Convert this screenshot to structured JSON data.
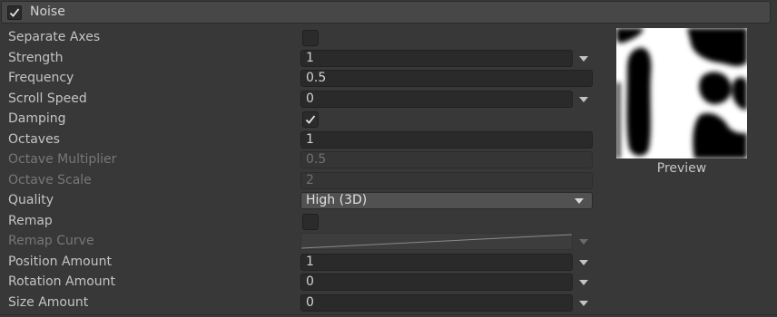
{
  "header": {
    "title": "Noise",
    "enabled": true
  },
  "rows": {
    "separate_axes": {
      "label": "Separate Axes",
      "checked": false
    },
    "strength": {
      "label": "Strength",
      "value": "1"
    },
    "frequency": {
      "label": "Frequency",
      "value": "0.5"
    },
    "scroll_speed": {
      "label": "Scroll Speed",
      "value": "0"
    },
    "damping": {
      "label": "Damping",
      "checked": true
    },
    "octaves": {
      "label": "Octaves",
      "value": "1"
    },
    "octave_multiplier": {
      "label": "Octave Multiplier",
      "value": "0.5",
      "disabled": true
    },
    "octave_scale": {
      "label": "Octave Scale",
      "value": "2",
      "disabled": true
    },
    "quality": {
      "label": "Quality",
      "value": "High (3D)"
    },
    "remap": {
      "label": "Remap",
      "checked": false
    },
    "remap_curve": {
      "label": "Remap Curve",
      "disabled": true
    },
    "position_amount": {
      "label": "Position Amount",
      "value": "1"
    },
    "rotation_amount": {
      "label": "Rotation Amount",
      "value": "0"
    },
    "size_amount": {
      "label": "Size Amount",
      "value": "0"
    }
  },
  "preview": {
    "label": "Preview"
  },
  "colors": {
    "background": "#383838",
    "field": "#2a2a2a",
    "text": "#c4c4c4",
    "disabled_text": "#777777"
  }
}
